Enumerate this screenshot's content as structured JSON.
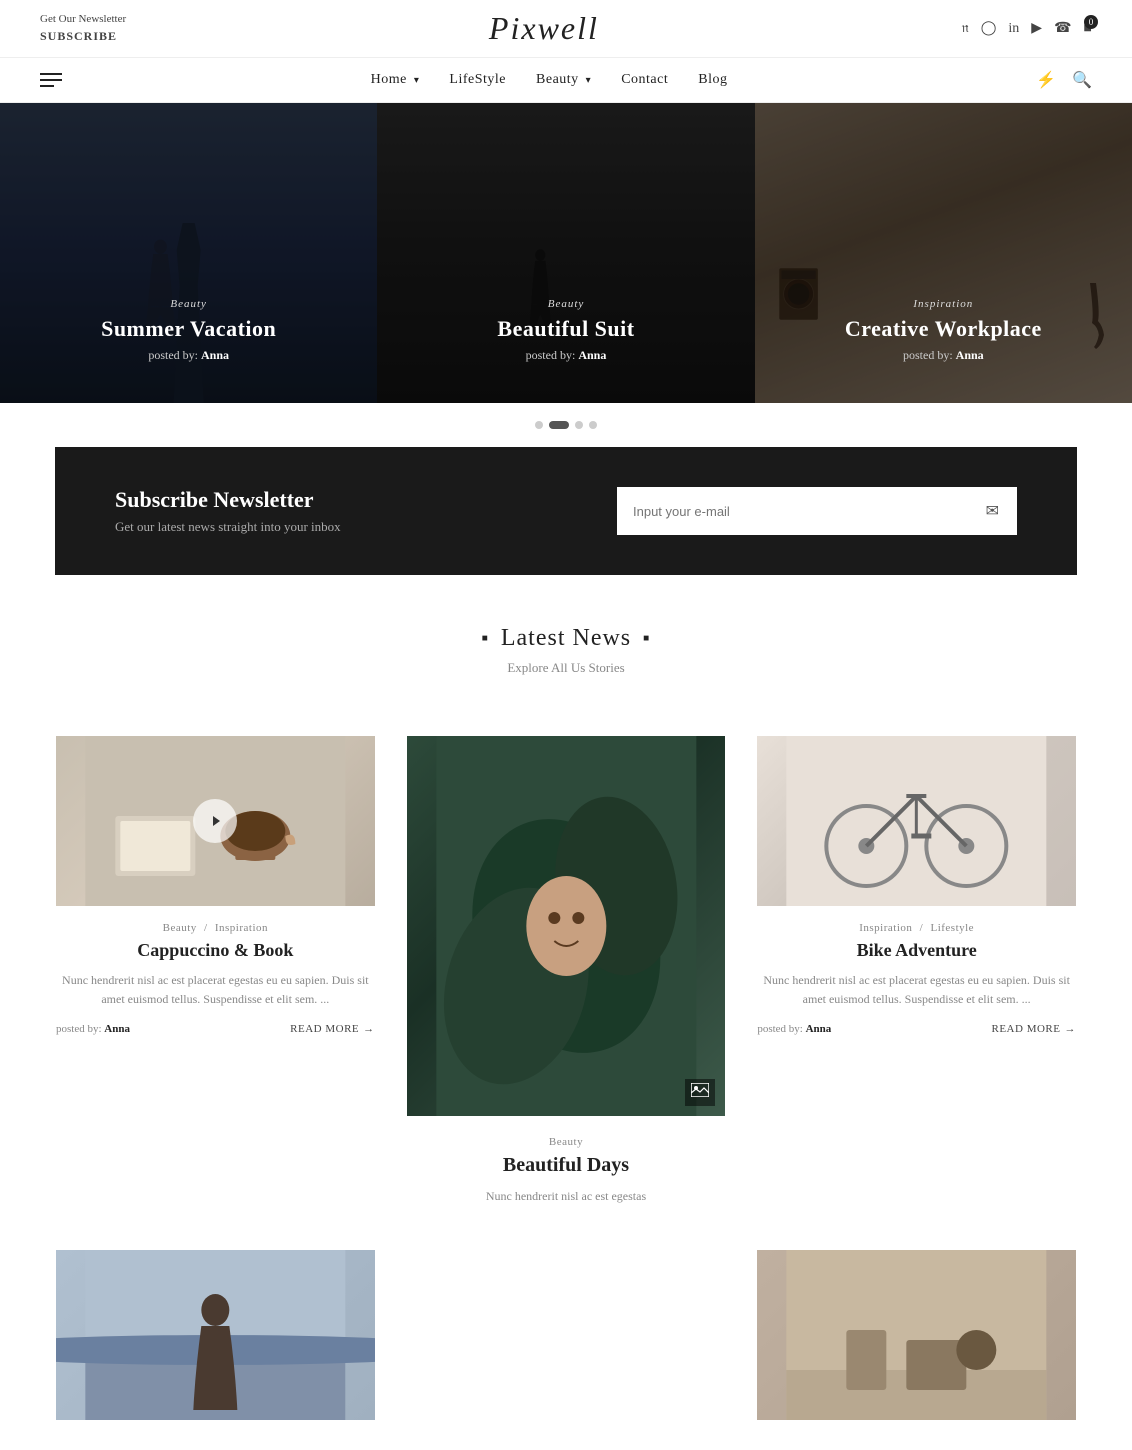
{
  "topbar": {
    "newsletter_label": "Get Our Newsletter",
    "subscribe_label": "SUBSCRIBE"
  },
  "logo": {
    "text": "Pixwell"
  },
  "social_icons": [
    "pinterest",
    "instagram",
    "linkedin",
    "youtube",
    "whatsapp",
    "camera"
  ],
  "cart": {
    "count": "0"
  },
  "nav": {
    "links": [
      {
        "label": "Home",
        "has_arrow": true
      },
      {
        "label": "LifeStyle",
        "has_arrow": false
      },
      {
        "label": "Beauty",
        "has_arrow": true
      },
      {
        "label": "Contact",
        "has_arrow": false
      },
      {
        "label": "Blog",
        "has_arrow": false
      }
    ]
  },
  "hero_slides": [
    {
      "category": "Beauty",
      "title": "Summer Vacation",
      "author_prefix": "posted by:",
      "author": "Anna"
    },
    {
      "category": "Beauty",
      "title": "Beautiful Suit",
      "author_prefix": "posted by:",
      "author": "Anna"
    },
    {
      "category": "Inspiration",
      "title": "Creative Workplace",
      "author_prefix": "posted by:",
      "author": "Anna"
    }
  ],
  "slider_dots": [
    1,
    2,
    3,
    4
  ],
  "active_dot": 1,
  "newsletter": {
    "title": "Subscribe Newsletter",
    "subtitle": "Get our latest news straight into your inbox",
    "input_placeholder": "Input your e-mail"
  },
  "latest_news": {
    "title": "Latest News",
    "subtitle": "Explore All Us Stories"
  },
  "news_cards": [
    {
      "id": 1,
      "categories": [
        "Beauty",
        "Inspiration"
      ],
      "title": "Cappuccino & Book",
      "excerpt": "Nunc hendrerit nisl ac est placerat egestas eu eu sapien. Duis sit amet euismod tellus. Suspendisse et elit sem. ...",
      "author_prefix": "posted by:",
      "author": "Anna",
      "read_more": "READ MORE",
      "has_play": true,
      "image_type": "news-img-1"
    },
    {
      "id": 2,
      "categories": [
        "Beauty"
      ],
      "title": "Beautiful Days",
      "excerpt": "Nunc hendrerit nisl ac est egestas",
      "author_prefix": "",
      "author": "",
      "read_more": "",
      "has_image_icon": true,
      "image_type": "news-img-2",
      "is_tall": true
    },
    {
      "id": 3,
      "categories": [
        "Inspiration",
        "Lifestyle"
      ],
      "title": "Bike Adventure",
      "excerpt": "Nunc hendrerit nisl ac est placerat egestas eu eu sapien. Duis sit amet euismod tellus. Suspendisse et elit sem. ...",
      "author_prefix": "posted by:",
      "author": "Anna",
      "read_more": "READ MORE",
      "has_play": false,
      "image_type": "news-img-3"
    }
  ]
}
